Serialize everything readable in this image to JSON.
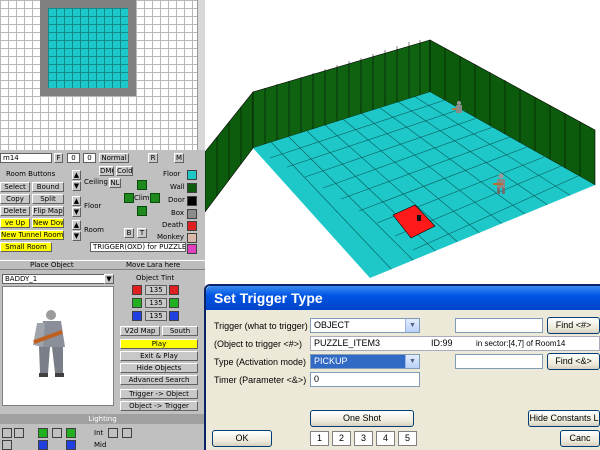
{
  "editor": {
    "room_name": "m14",
    "toggle_f": "F",
    "value_0a": "0",
    "value_0b": "0",
    "normal_label": "Normal",
    "r_label": "R",
    "m_label": "M",
    "room_buttons_label": "Room Buttons",
    "select_label": "Select",
    "bound_label": "Bound",
    "copy_label": "Copy",
    "split_label": "Split",
    "delete_label": "Delete",
    "flip_map_label": "Flip Map",
    "move_up_label": "ve Up",
    "new_down_label": "New Down",
    "new_tunnel_label": "New Tunnel Room",
    "small_room_label": "Small Room",
    "trigger_text": "TRIGGER(OXD) for PUZZLE_I",
    "ceiling_label": "Ceiling",
    "floor_label": "Floor",
    "room_label": "Room",
    "dm6_label": "DM6",
    "cold_label": "Cold",
    "nl_label": "NL",
    "climb_label": "Climb",
    "b_label": "B",
    "t_label": "T",
    "legend": [
      "Floor",
      "Wall",
      "Door",
      "Box",
      "Death",
      "Monkey",
      "Trigger"
    ],
    "place_object_label": "Place Object",
    "move_lara_label": "Move Lara here",
    "object_select": "BADDY_1",
    "object_tint_label": "Object Tint",
    "tint_values": [
      "135",
      "135",
      "135"
    ],
    "v2d_map_label": "V2d Map",
    "south_label": "South",
    "play_label": "Play",
    "exit_play_label": "Exit & Play",
    "hide_objects_label": "Hide Objects",
    "advanced_search_label": "Advanced Search",
    "trigger_to_object_label": "Trigger -> Object",
    "object_to_trigger_label": "Object -> Trigger",
    "lighting_label": "Lighting",
    "int_label": "Int",
    "mid_label": "Mid"
  },
  "dialog": {
    "title": "Set Trigger Type",
    "trigger_label": "Trigger (what to trigger) :",
    "trigger_value": "OBJECT",
    "object_label": "(Object to trigger <#>)",
    "object_value": "PUZZLE_ITEM3",
    "object_id": "ID:99",
    "object_location": "in sector:[4,7] of Room14",
    "type_label": "Type (Activation mode)",
    "type_value": "PICKUP",
    "timer_label": "Timer (Parameter <&>)",
    "timer_value": "0",
    "find_hash_label": "Find <#>",
    "find_amp_label": "Find <&>",
    "one_shot_label": "One Shot",
    "hide_constants_label": "Hide Constants L",
    "ok_label": "OK",
    "cancel_label": "Canc",
    "code_buttons": [
      "1",
      "2",
      "3",
      "4",
      "5"
    ]
  },
  "colors": {
    "floor": "#1ec8c8",
    "wall": "#0d5c0d",
    "trigger_tile": "#ff1a1a",
    "dialog_title": "#0055e5",
    "highlight": "#316ac5"
  }
}
